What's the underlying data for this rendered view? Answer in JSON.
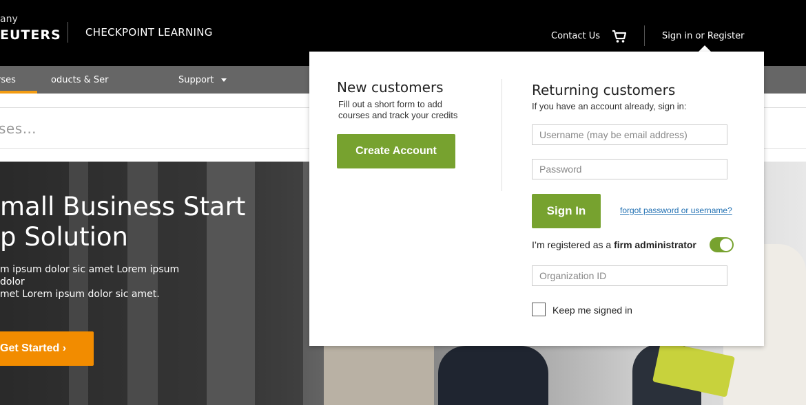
{
  "header": {
    "brand_line1": "any",
    "brand_line2": "EUTERS",
    "product_name": "CHECKPOINT LEARNING",
    "contact_label": "Contact Us",
    "cart_icon": "cart-icon",
    "signin_label": "Sign in or Register"
  },
  "nav": {
    "items": [
      {
        "label": "rses"
      },
      {
        "label": "oducts & Ser"
      },
      {
        "label": "Support"
      }
    ]
  },
  "search": {
    "placeholder": "ses…"
  },
  "hero": {
    "title_line1": "mall Business Start",
    "title_line2": "p Solution",
    "body_line1": "m ipsum dolor sic amet Lorem ipsum dolor",
    "body_line2": "met Lorem ipsum dolor sic amet.",
    "cta_label": "Get Started  ›"
  },
  "popup": {
    "new": {
      "heading": "New customers",
      "text_line1": "Fill out a short form to add",
      "text_line2": "courses and track your credits",
      "create_label": "Create Account"
    },
    "returning": {
      "heading": "Returning customers",
      "subtext": "If you have an account already, sign in:",
      "username_placeholder": "Username (may be email address)",
      "password_placeholder": "Password",
      "signin_label": "Sign In",
      "forgot_label": "forgot password or username?",
      "firm_label_prefix": "I’m registered as a ",
      "firm_label_bold": "firm administrator",
      "firm_toggle_on": true,
      "org_placeholder": "Organization ID",
      "keep_label": "Keep me signed in"
    }
  },
  "colors": {
    "accent_green": "#77a22f",
    "accent_orange": "#f28c00",
    "topbar": "#000000",
    "navbar": "#666666",
    "link": "#1f6fb2"
  }
}
